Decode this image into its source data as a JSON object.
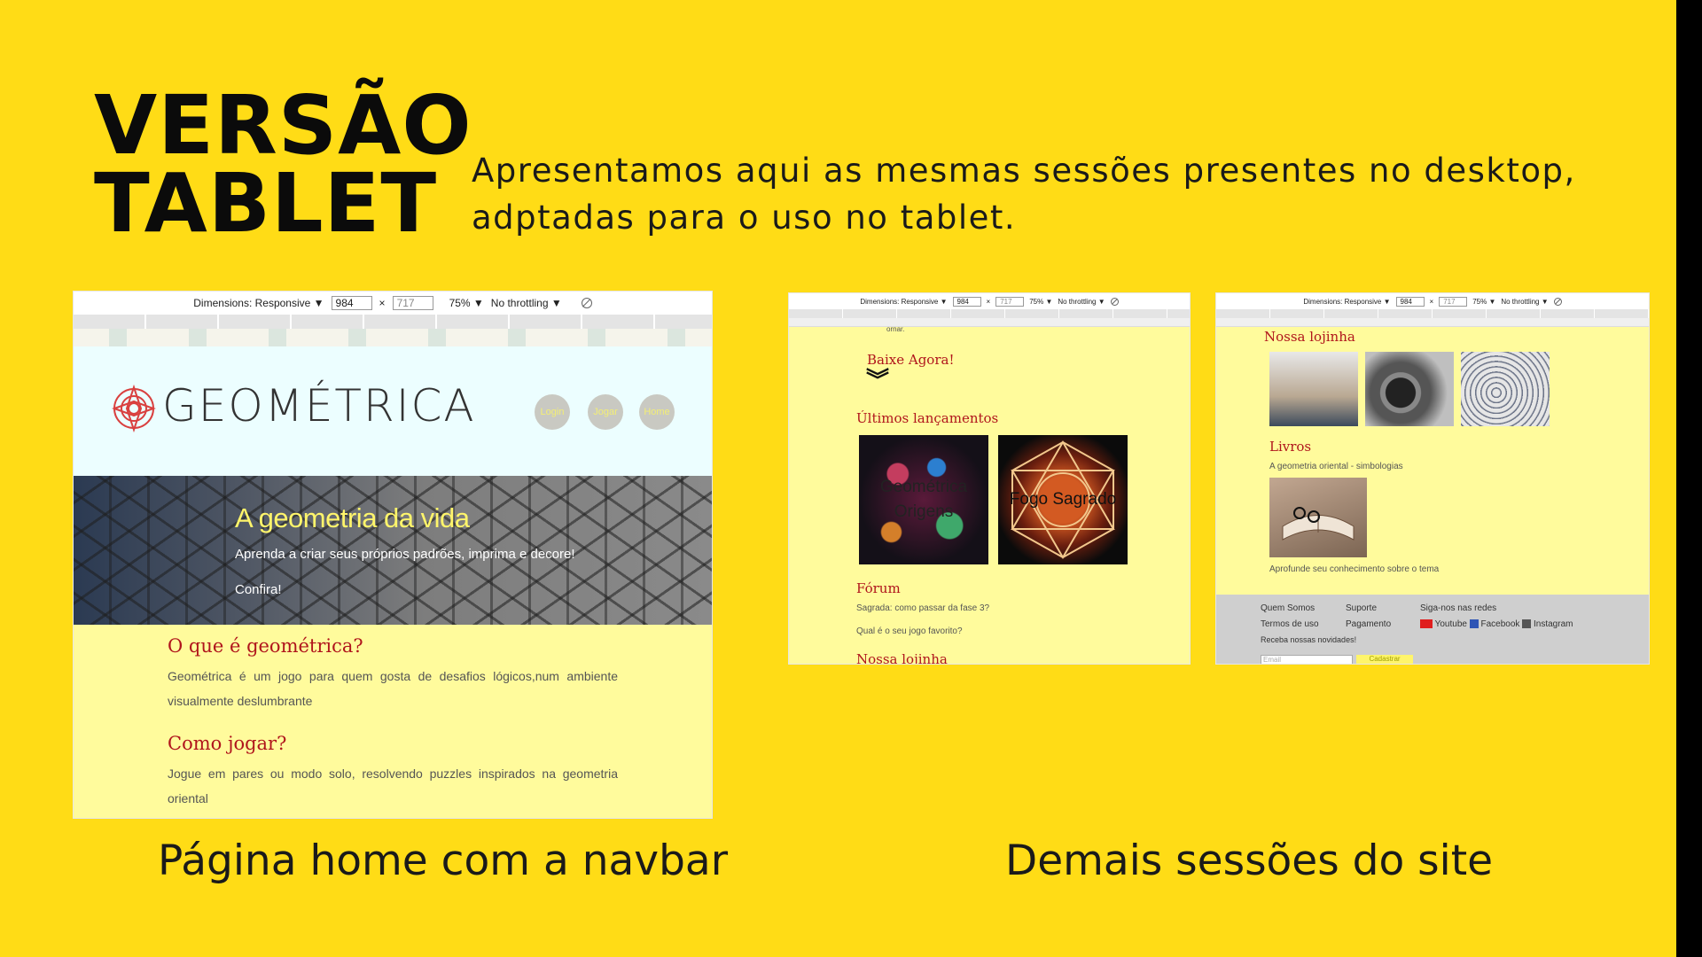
{
  "slide": {
    "title_line1": "VERSÃO",
    "title_line2": "TABLET",
    "intro": "Apresentamos aqui as mesmas sessões presentes no desktop, adptadas para o uso no tablet.",
    "caption_left": "Página home com  a navbar",
    "caption_right": "Demais sessões do site",
    "background_color": "#FFDC16"
  },
  "devtools": {
    "dimensions_label": "Dimensions: Responsive ▼",
    "width_value": "984",
    "times": "×",
    "height_value": "717",
    "zoom": "75% ▼",
    "throttling": "No throttling ▼"
  },
  "home": {
    "logo_text": "GEOMÉTRICA",
    "nav": [
      "Login",
      "Jogar",
      "Home"
    ],
    "hero_title": "A geometria da vida",
    "hero_subtitle": "Aprenda a criar seus próprios padrões, imprima e decore!",
    "hero_link": "Confira!",
    "q1_title": "O que é geométrica?",
    "q1_text": "Geométrica é um jogo para quem gosta de desafios lógicos,num ambiente visualmente deslumbrante",
    "q2_title": "Como jogar?",
    "q2_text": "Jogue em pares ou modo solo, resolvendo puzzles inspirados na geometria oriental"
  },
  "sections": {
    "cut_top_text": "ornar.",
    "download_title": "Baixe Agora!",
    "launches_title": "Últimos lançamentos",
    "game1": "Geométrica Origens",
    "game2": "Fogo Sagrado",
    "forum_title": "Fórum",
    "forum_q1": "Sagrada: como passar da fase 3?",
    "forum_q2": "Qual é o seu jogo favorito?",
    "store_title": "Nossa lojinha"
  },
  "sections2": {
    "store_title": "Nossa lojinha",
    "books_title": "Livros",
    "book_name": "A geometria oriental - simbologias",
    "book_caption": "Aprofunde seu conhecimento sobre o tema",
    "footer": {
      "about": "Quem Somos",
      "terms": "Termos de uso",
      "support": "Suporte",
      "payment": "Pagamento",
      "follow": "Siga-nos nas redes",
      "youtube": "Youtube",
      "facebook": "Facebook",
      "instagram": "Instagram",
      "newsletter": "Receba nossas novidades!",
      "email_placeholder": "Email",
      "subscribe": "Cadastrar"
    }
  }
}
